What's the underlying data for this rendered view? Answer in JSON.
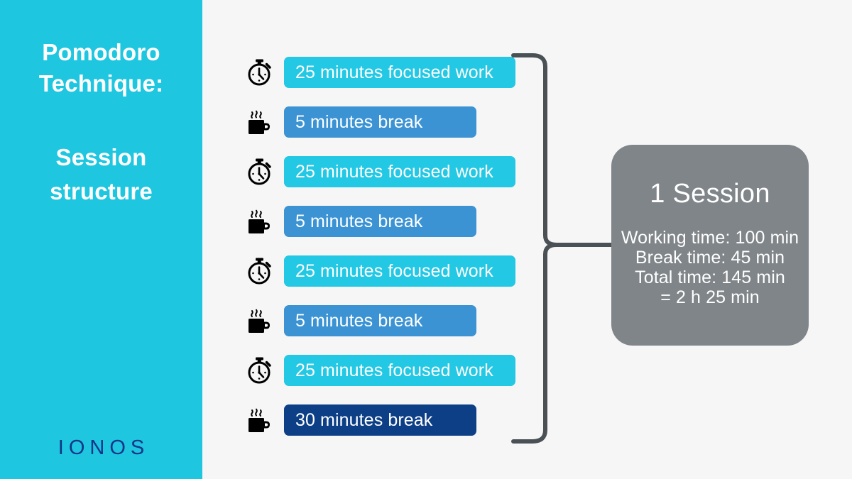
{
  "sidebar": {
    "title": "Pomodoro\nTechnique:",
    "subtitle": "Session\nstructure",
    "logo": "IONOS",
    "background_color": "#1ec6e0",
    "logo_color": "#10368a"
  },
  "colors": {
    "page_background": "#f6f6f6",
    "work_bar": "#22c8e4",
    "break_bar": "#3b93d4",
    "long_break_bar": "#0d3f87",
    "session_card": "#808589",
    "brace": "#4a5156",
    "icon": "#000000",
    "text_on_bar": "#ffffff"
  },
  "steps": [
    {
      "icon": "stopwatch-icon",
      "label": "25 minutes focused work",
      "type": "work"
    },
    {
      "icon": "coffee-cup-icon",
      "label": "5 minutes break",
      "type": "brk"
    },
    {
      "icon": "stopwatch-icon",
      "label": "25 minutes focused work",
      "type": "work"
    },
    {
      "icon": "coffee-cup-icon",
      "label": "5 minutes break",
      "type": "brk"
    },
    {
      "icon": "stopwatch-icon",
      "label": "25 minutes focused work",
      "type": "work"
    },
    {
      "icon": "coffee-cup-icon",
      "label": "5 minutes break",
      "type": "brk"
    },
    {
      "icon": "stopwatch-icon",
      "label": "25 minutes focused work",
      "type": "work"
    },
    {
      "icon": "coffee-cup-icon",
      "label": "30 minutes break",
      "type": "long"
    }
  ],
  "session": {
    "title": "1 Session",
    "details": "Working time: 100 min\nBreak time: 45 min\nTotal time: 145 min\n= 2 h 25 min",
    "working_time": "100 min",
    "break_time": "45 min",
    "total_time": "145 min",
    "total_time_hours": "2 h 25 min"
  }
}
